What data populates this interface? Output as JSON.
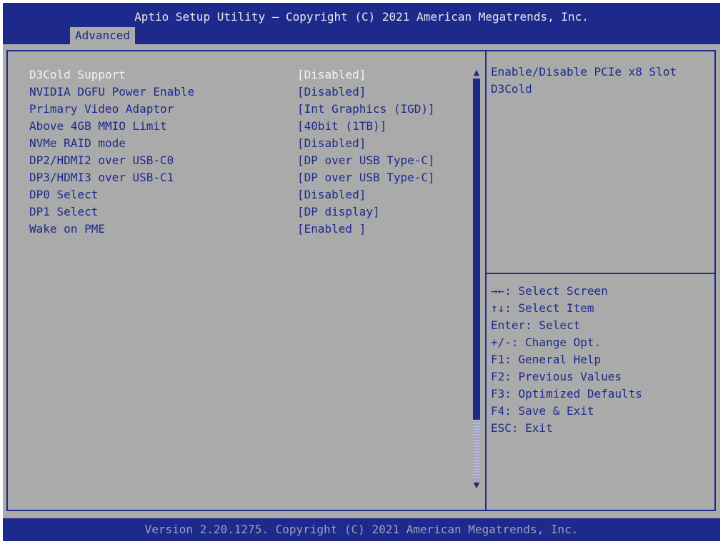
{
  "header": {
    "title": "Aptio Setup Utility – Copyright (C) 2021 American Megatrends, Inc.",
    "active_tab": "Advanced"
  },
  "settings": [
    {
      "label": "D3Cold Support",
      "value": "[Disabled]",
      "selected": true
    },
    {
      "label": "NVIDIA DGFU Power Enable",
      "value": "[Disabled]",
      "selected": false
    },
    {
      "label": "Primary Video Adaptor",
      "value": "[Int Graphics (IGD)]",
      "selected": false
    },
    {
      "label": "Above 4GB MMIO Limit",
      "value": "[40bit (1TB)]",
      "selected": false
    },
    {
      "label": "NVMe RAID mode",
      "value": "[Disabled]",
      "selected": false
    },
    {
      "label": "DP2/HDMI2 over USB-C0",
      "value": "[DP over USB Type-C]",
      "selected": false
    },
    {
      "label": "DP3/HDMI3 over USB-C1",
      "value": "[DP over USB Type-C]",
      "selected": false
    },
    {
      "label": "DP0 Select",
      "value": "[Disabled]",
      "selected": false
    },
    {
      "label": "DP1 Select",
      "value": "[DP display]",
      "selected": false
    },
    {
      "label": "Wake on PME",
      "value": "[Enabled ]",
      "selected": false
    }
  ],
  "help": {
    "line1": "Enable/Disable PCIe x8 Slot",
    "line2": "D3Cold"
  },
  "keys": [
    "→←: Select Screen",
    "↑↓: Select Item",
    "Enter: Select",
    "+/-: Change Opt.",
    "F1: General Help",
    "F2: Previous Values",
    "F3: Optimized Defaults",
    "F4: Save & Exit",
    "ESC: Exit"
  ],
  "scrollbar": {
    "up_arrow": "▲",
    "down_arrow": "▼"
  },
  "footer": {
    "text": "Version 2.20.1275. Copyright (C) 2021 American Megatrends, Inc."
  },
  "colors": {
    "bios_blue": "#1d2a8c",
    "panel_gray": "#aaaaaa",
    "selected_text": "#f4f4f4"
  }
}
